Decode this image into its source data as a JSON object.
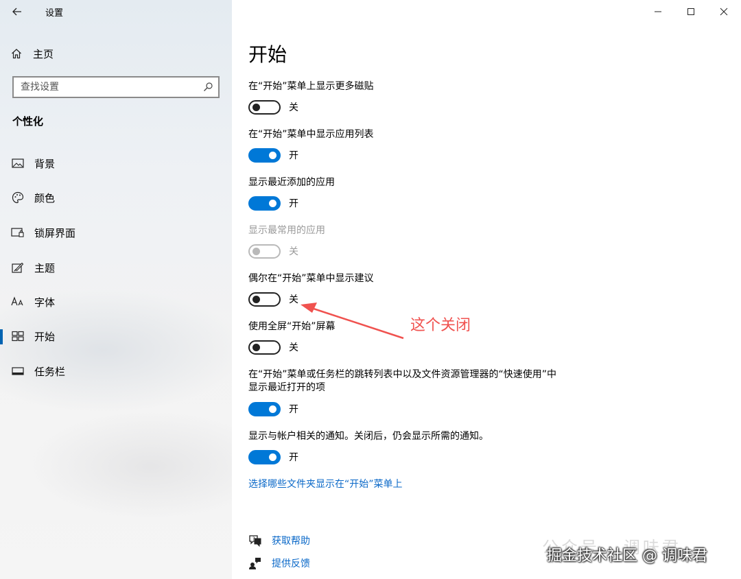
{
  "window": {
    "title": "设置"
  },
  "sidebar": {
    "home_label": "主页",
    "search_placeholder": "查找设置",
    "section_title": "个性化",
    "items": [
      {
        "label": "背景",
        "icon": "picture-icon"
      },
      {
        "label": "颜色",
        "icon": "palette-icon"
      },
      {
        "label": "锁屏界面",
        "icon": "lock-screen-icon"
      },
      {
        "label": "主题",
        "icon": "theme-brush-icon"
      },
      {
        "label": "字体",
        "icon": "font-icon"
      },
      {
        "label": "开始",
        "icon": "start-grid-icon",
        "active": true
      },
      {
        "label": "任务栏",
        "icon": "taskbar-icon"
      }
    ]
  },
  "main": {
    "title": "开始",
    "settings": [
      {
        "label": "在“开始”菜单上显示更多磁贴",
        "state": "关",
        "on": false
      },
      {
        "label": "在“开始”菜单中显示应用列表",
        "state": "开",
        "on": true
      },
      {
        "label": "显示最近添加的应用",
        "state": "开",
        "on": true
      },
      {
        "label": "显示最常用的应用",
        "state": "关",
        "on": false,
        "disabled": true
      },
      {
        "label": "偶尔在“开始”菜单中显示建议",
        "state": "关",
        "on": false
      },
      {
        "label": "使用全屏“开始”屏幕",
        "state": "关",
        "on": false
      },
      {
        "label_line1": "在“开始”菜单或任务栏的跳转列表中以及文件资源管理器的“快速使用”中",
        "label_line2": "显示最近打开的项",
        "state": "开",
        "on": true
      },
      {
        "label": "显示与帐户相关的通知。关闭后，仍会显示所需的通知。",
        "state": "开",
        "on": true
      }
    ],
    "folders_link": "选择哪些文件夹显示在“开始”菜单上",
    "help": {
      "get_help": "获取帮助",
      "feedback": "提供反馈"
    }
  },
  "annotation": {
    "text": "这个关闭",
    "color": "#f0524f"
  },
  "watermark": {
    "line1": "公众号 · 调味君",
    "line2": "掘金技术社区 @ 调味君"
  },
  "colors": {
    "accent": "#0078d7",
    "link": "#0a68c8"
  }
}
